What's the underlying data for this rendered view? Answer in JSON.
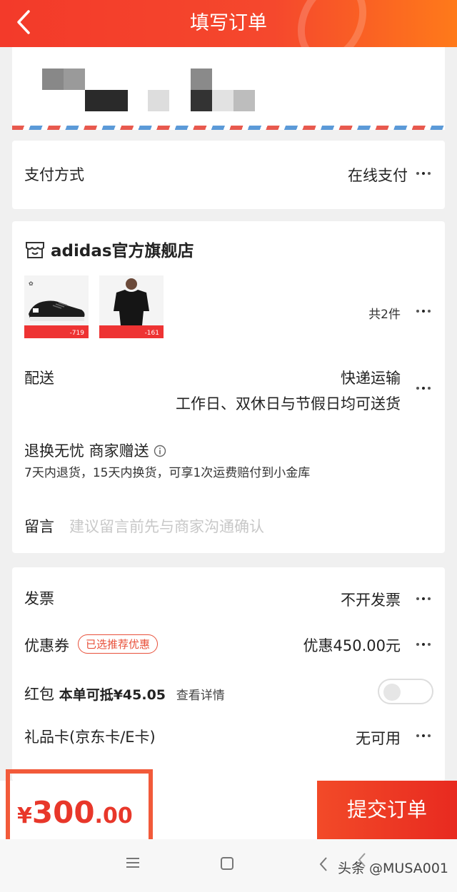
{
  "header": {
    "title": "填写订单"
  },
  "payment": {
    "label": "支付方式",
    "value": "在线支付"
  },
  "store": {
    "name": "adidas官方旗舰店",
    "products": [
      {
        "badge": "-719"
      },
      {
        "badge": "-161"
      }
    ],
    "count": "共2件",
    "shipping": {
      "label": "配送",
      "method": "快递运输",
      "detail": "工作日、双休日与节假日均可送货"
    },
    "returns": {
      "title": "退换无忧 商家赠送",
      "detail": "7天内退货，15天内换货，可享1次运费赔付到小金库"
    },
    "note": {
      "label": "留言",
      "placeholder": "建议留言前先与商家沟通确认"
    }
  },
  "extras": {
    "invoice": {
      "label": "发票",
      "value": "不开发票"
    },
    "coupon": {
      "label": "优惠券",
      "badge": "已选推荐优惠",
      "value": "优惠450.00元"
    },
    "redpacket": {
      "label": "红包",
      "amount_text": "本单可抵¥45.05",
      "link": "查看详情",
      "enabled": false
    },
    "giftcard": {
      "label": "礼品卡(京东卡/E卡)",
      "value": "无可用"
    }
  },
  "footer": {
    "price_currency": "¥",
    "price_integer": "300",
    "price_decimal": ".00",
    "submit_label": "提交订单"
  },
  "watermark": "头条 @MUSA001",
  "colors": {
    "brand": "#f33a2a",
    "highlight": "#f25a3a"
  }
}
